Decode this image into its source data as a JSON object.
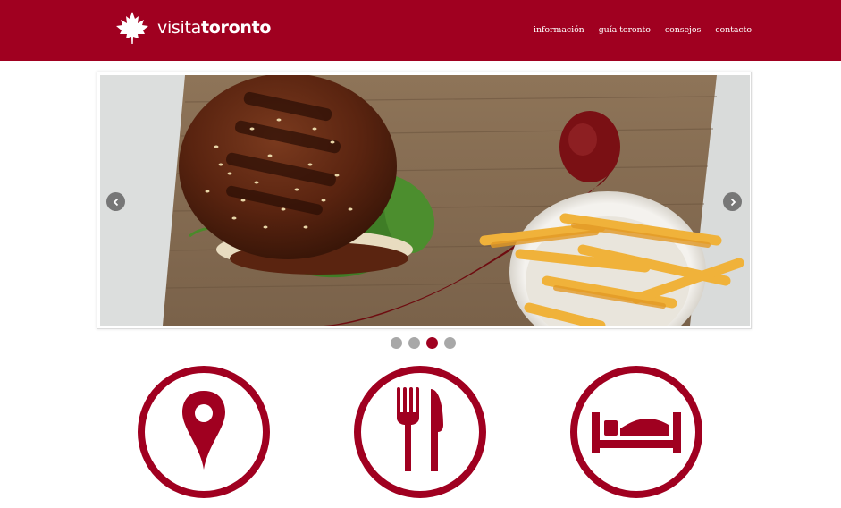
{
  "brand": {
    "name_light": "visita",
    "name_bold": "toronto",
    "logo_icon": "maple-leaf-icon",
    "color": "#a00020"
  },
  "nav": {
    "items": [
      {
        "label": "información"
      },
      {
        "label": "guía toronto"
      },
      {
        "label": "consejos"
      },
      {
        "label": "contacto"
      }
    ]
  },
  "slider": {
    "slide_description": "burger-and-fries-photo",
    "prev_icon": "chevron-left-icon",
    "next_icon": "chevron-right-icon",
    "dot_count": 4,
    "active_dot": 3,
    "dot_color": "#a8a8a8",
    "active_dot_color": "#a00020"
  },
  "features": [
    {
      "icon": "map-pin-icon"
    },
    {
      "icon": "fork-knife-icon"
    },
    {
      "icon": "bed-icon"
    }
  ]
}
